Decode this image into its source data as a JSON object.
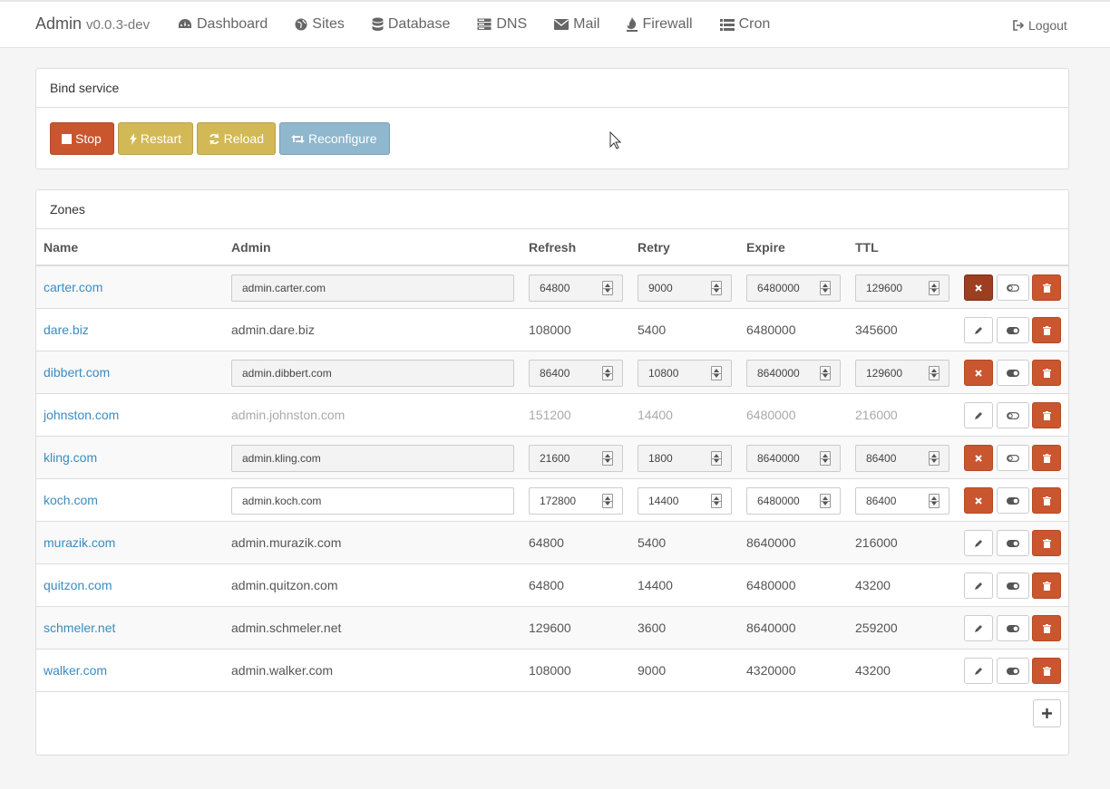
{
  "navbar": {
    "brand": "Admin",
    "version": "v0.0.3-dev",
    "items": [
      {
        "label": "Dashboard",
        "icon": "dashboard-icon"
      },
      {
        "label": "Sites",
        "icon": "globe-icon"
      },
      {
        "label": "Database",
        "icon": "database-icon"
      },
      {
        "label": "DNS",
        "icon": "server-icon"
      },
      {
        "label": "Mail",
        "icon": "envelope-icon"
      },
      {
        "label": "Firewall",
        "icon": "fire-icon"
      },
      {
        "label": "Cron",
        "icon": "list-icon"
      }
    ],
    "logout": "Logout"
  },
  "bind_panel": {
    "title": "Bind service",
    "buttons": {
      "stop": "Stop",
      "restart": "Restart",
      "reload": "Reload",
      "reconfigure": "Reconfigure"
    }
  },
  "zones_panel": {
    "title": "Zones",
    "columns": [
      "Name",
      "Admin",
      "Refresh",
      "Retry",
      "Expire",
      "TTL"
    ],
    "rows": [
      {
        "name": "carter.com",
        "admin": "admin.carter.com",
        "refresh": "64800",
        "retry": "9000",
        "expire": "6480000",
        "ttl": "129600",
        "editing": true
      },
      {
        "name": "dare.biz",
        "admin": "admin.dare.biz",
        "refresh": "108000",
        "retry": "5400",
        "expire": "6480000",
        "ttl": "345600",
        "editing": false
      },
      {
        "name": "dibbert.com",
        "admin": "admin.dibbert.com",
        "refresh": "86400",
        "retry": "10800",
        "expire": "8640000",
        "ttl": "129600",
        "editing": true
      },
      {
        "name": "johnston.com",
        "admin": "admin.johnston.com",
        "refresh": "151200",
        "retry": "14400",
        "expire": "6480000",
        "ttl": "216000",
        "editing": false
      },
      {
        "name": "kling.com",
        "admin": "admin.kling.com",
        "refresh": "21600",
        "retry": "1800",
        "expire": "8640000",
        "ttl": "86400",
        "editing": true
      },
      {
        "name": "koch.com",
        "admin": "admin.koch.com",
        "refresh": "172800",
        "retry": "14400",
        "expire": "6480000",
        "ttl": "86400",
        "editing": true
      },
      {
        "name": "murazik.com",
        "admin": "admin.murazik.com",
        "refresh": "64800",
        "retry": "5400",
        "expire": "8640000",
        "ttl": "216000",
        "editing": false
      },
      {
        "name": "quitzon.com",
        "admin": "admin.quitzon.com",
        "refresh": "64800",
        "retry": "14400",
        "expire": "6480000",
        "ttl": "43200",
        "editing": false
      },
      {
        "name": "schmeler.net",
        "admin": "admin.schmeler.net",
        "refresh": "129600",
        "retry": "3600",
        "expire": "8640000",
        "ttl": "259200",
        "editing": false
      },
      {
        "name": "walker.com",
        "admin": "admin.walker.com",
        "refresh": "108000",
        "retry": "9000",
        "expire": "4320000",
        "ttl": "43200",
        "editing": false
      }
    ]
  },
  "colors": {
    "danger": "#c9562e",
    "warning": "#d2b955",
    "info": "#8fb7cd",
    "link": "#3a8cc0"
  }
}
